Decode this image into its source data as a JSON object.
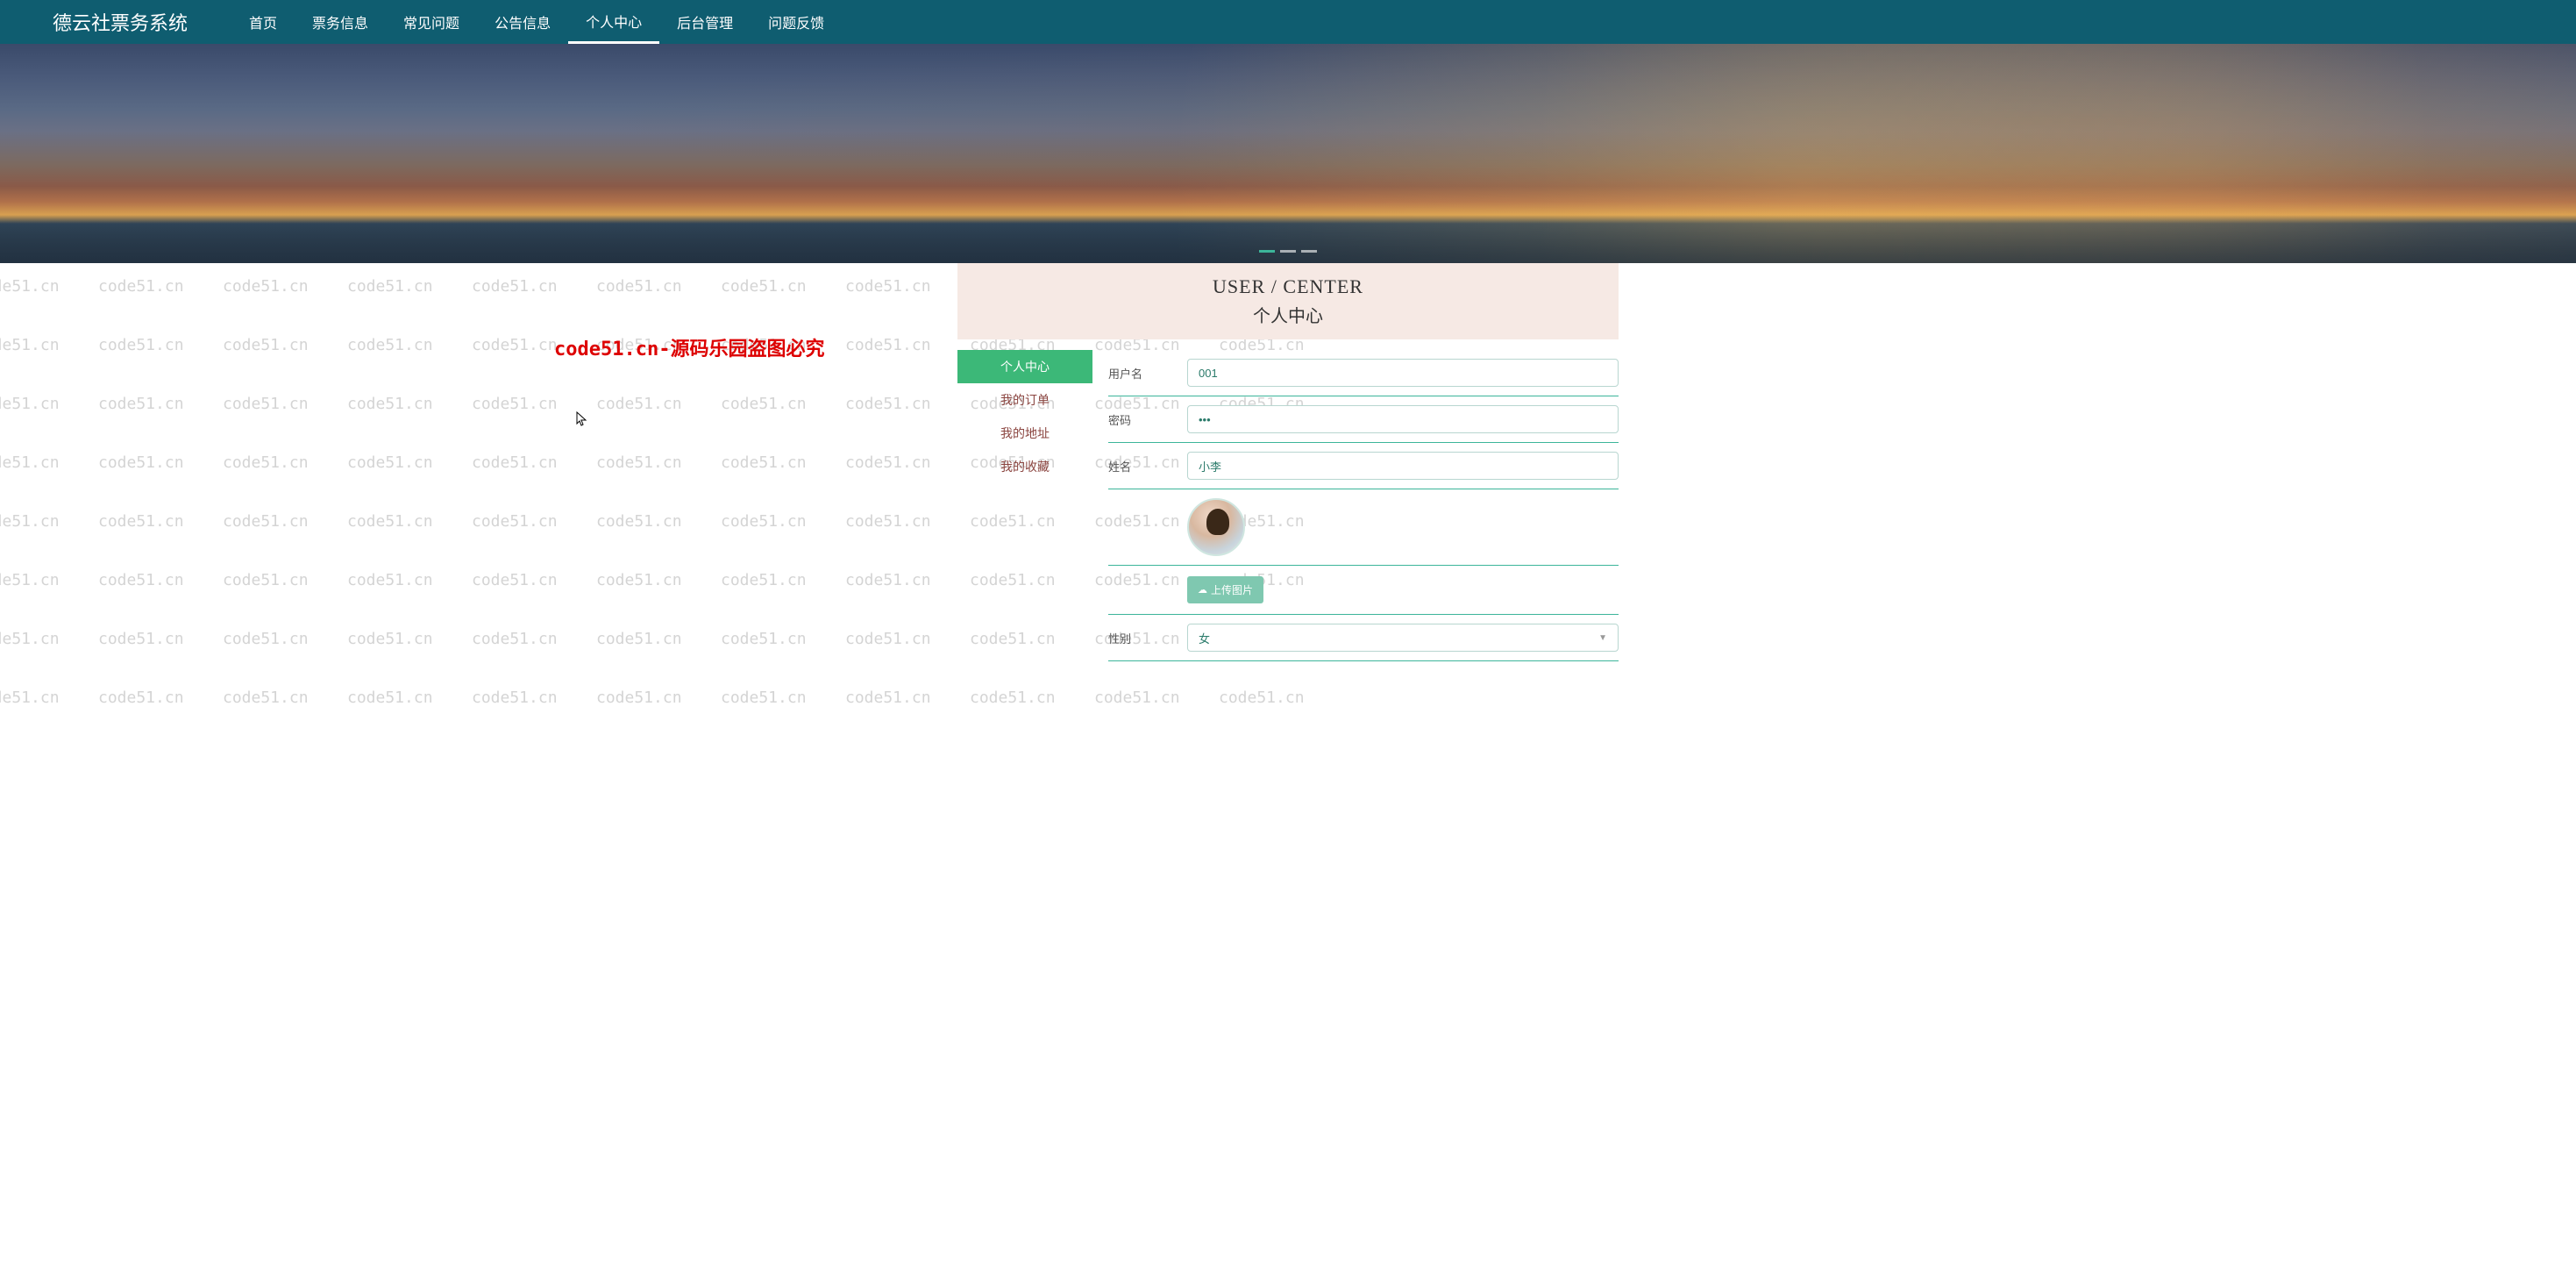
{
  "watermark_text": "code51.cn",
  "nav": {
    "brand": "德云社票务系统",
    "items": [
      "首页",
      "票务信息",
      "常见问题",
      "公告信息",
      "个人中心",
      "后台管理",
      "问题反馈"
    ],
    "active_index": 4
  },
  "carousel": {
    "count": 3,
    "active": 0
  },
  "page_header": {
    "en": "USER / CENTER",
    "cn": "个人中心"
  },
  "sidebar": {
    "items": [
      "个人中心",
      "我的订单",
      "我的地址",
      "我的收藏"
    ],
    "active_index": 0
  },
  "form": {
    "username": {
      "label": "用户名",
      "value": "001"
    },
    "password": {
      "label": "密码",
      "value": "•••"
    },
    "name": {
      "label": "姓名",
      "value": "小李"
    },
    "upload": {
      "label": "上传图片"
    },
    "gender": {
      "label": "性别",
      "value": "女"
    }
  },
  "overlay_text": "code51.cn-源码乐园盗图必究"
}
